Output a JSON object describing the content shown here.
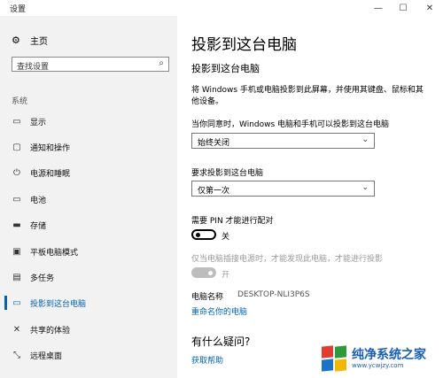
{
  "window": {
    "title": "设置",
    "controls": [
      "—",
      "☐",
      "✕"
    ]
  },
  "sidebar": {
    "home_label": "主页",
    "search_placeholder": "查找设置",
    "section_label": "系统",
    "items": [
      {
        "label": "显示",
        "icon": "monitor-icon"
      },
      {
        "label": "通知和操作",
        "icon": "notification-icon"
      },
      {
        "label": "电源和睡眠",
        "icon": "power-icon"
      },
      {
        "label": "电池",
        "icon": "battery-icon"
      },
      {
        "label": "存储",
        "icon": "storage-icon"
      },
      {
        "label": "平板电脑模式",
        "icon": "tablet-mode-icon"
      },
      {
        "label": "多任务",
        "icon": "multitask-icon"
      },
      {
        "label": "投影到这台电脑",
        "icon": "project-icon",
        "active": true
      },
      {
        "label": "共享的体验",
        "icon": "shared-experience-icon"
      },
      {
        "label": "远程桌面",
        "icon": "remote-desktop-icon"
      }
    ]
  },
  "main": {
    "title": "投影到这台电脑",
    "subtitle": "投影到这台电脑",
    "description": "将 Windows 手机或电脑投影到此屏幕，并使用其键盘、鼠标和其他设备。",
    "setting1": {
      "label": "当你同意时，Windows 电脑和手机可以投影到这台电脑",
      "value": "始终关闭"
    },
    "setting2": {
      "label": "要求投影到这台电脑",
      "value": "仅第一次"
    },
    "pin": {
      "label": "需要 PIN 才能进行配对",
      "state": "关"
    },
    "power": {
      "label": "仅当电脑插接电源时，才能发现此电脑，才能进行投影",
      "state": "开"
    },
    "pc_name": {
      "key": "电脑名称",
      "value": "DESKTOP-NLI3P6S"
    },
    "rename_link": "重命名你的电脑",
    "help_heading": "有什么疑问?",
    "help_link": "获取帮助"
  },
  "watermark": {
    "title": "纯净系统之家",
    "url": "www.ycwjzy.com"
  },
  "colors": {
    "accent": "#0063b1",
    "sidebar_bg": "#f2f2f2"
  }
}
